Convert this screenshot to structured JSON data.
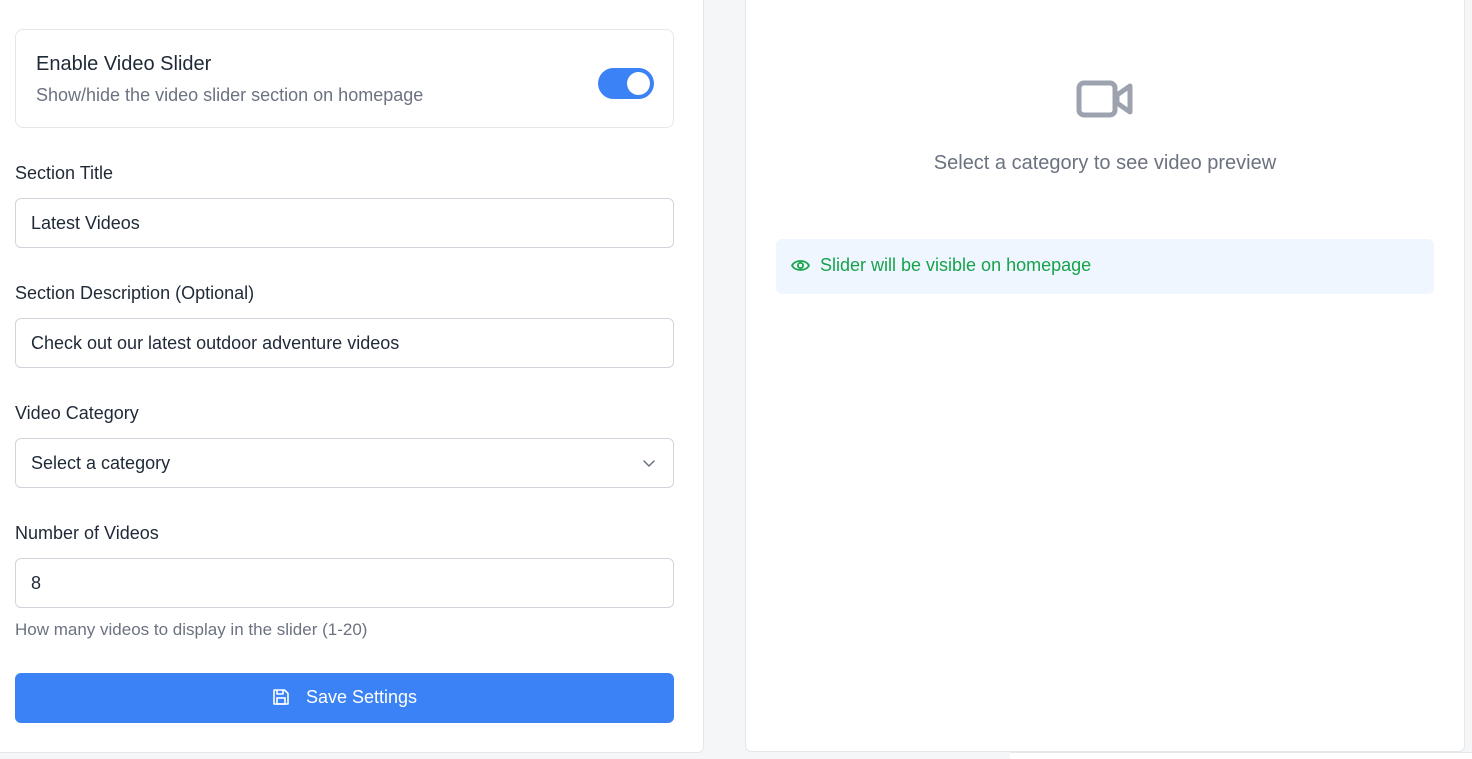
{
  "settings": {
    "toggle": {
      "title": "Enable Video Slider",
      "subtitle": "Show/hide the video slider section on homepage",
      "enabled": true
    },
    "section_title": {
      "label": "Section Title",
      "value": "Latest Videos"
    },
    "section_description": {
      "label": "Section Description (Optional)",
      "value": "Check out our latest outdoor adventure videos"
    },
    "video_category": {
      "label": "Video Category",
      "selected": "Select a category"
    },
    "number_of_videos": {
      "label": "Number of Videos",
      "value": "8",
      "help": "How many videos to display in the slider (1-20)"
    },
    "save_button": {
      "label": "Save Settings",
      "icon": "save-icon"
    }
  },
  "preview": {
    "icon": "video-camera-icon",
    "empty_text": "Select a category to see video preview",
    "status": {
      "icon": "eye-icon",
      "text": "Slider will be visible on homepage",
      "color": "#16a34a"
    }
  },
  "colors": {
    "accent": "#3b82f6",
    "status_bg": "#eff6ff",
    "status_text": "#16a34a",
    "muted_icon": "#9ca3af"
  }
}
